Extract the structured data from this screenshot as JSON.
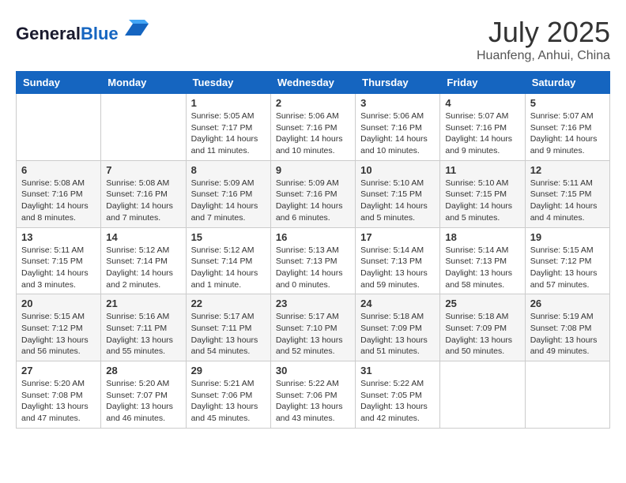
{
  "header": {
    "logo_general": "General",
    "logo_blue": "Blue",
    "month_year": "July 2025",
    "location": "Huanfeng, Anhui, China"
  },
  "weekdays": [
    "Sunday",
    "Monday",
    "Tuesday",
    "Wednesday",
    "Thursday",
    "Friday",
    "Saturday"
  ],
  "weeks": [
    [
      {
        "day": "",
        "info": ""
      },
      {
        "day": "",
        "info": ""
      },
      {
        "day": "1",
        "info": "Sunrise: 5:05 AM\nSunset: 7:17 PM\nDaylight: 14 hours and 11 minutes."
      },
      {
        "day": "2",
        "info": "Sunrise: 5:06 AM\nSunset: 7:16 PM\nDaylight: 14 hours and 10 minutes."
      },
      {
        "day": "3",
        "info": "Sunrise: 5:06 AM\nSunset: 7:16 PM\nDaylight: 14 hours and 10 minutes."
      },
      {
        "day": "4",
        "info": "Sunrise: 5:07 AM\nSunset: 7:16 PM\nDaylight: 14 hours and 9 minutes."
      },
      {
        "day": "5",
        "info": "Sunrise: 5:07 AM\nSunset: 7:16 PM\nDaylight: 14 hours and 9 minutes."
      }
    ],
    [
      {
        "day": "6",
        "info": "Sunrise: 5:08 AM\nSunset: 7:16 PM\nDaylight: 14 hours and 8 minutes."
      },
      {
        "day": "7",
        "info": "Sunrise: 5:08 AM\nSunset: 7:16 PM\nDaylight: 14 hours and 7 minutes."
      },
      {
        "day": "8",
        "info": "Sunrise: 5:09 AM\nSunset: 7:16 PM\nDaylight: 14 hours and 7 minutes."
      },
      {
        "day": "9",
        "info": "Sunrise: 5:09 AM\nSunset: 7:16 PM\nDaylight: 14 hours and 6 minutes."
      },
      {
        "day": "10",
        "info": "Sunrise: 5:10 AM\nSunset: 7:15 PM\nDaylight: 14 hours and 5 minutes."
      },
      {
        "day": "11",
        "info": "Sunrise: 5:10 AM\nSunset: 7:15 PM\nDaylight: 14 hours and 5 minutes."
      },
      {
        "day": "12",
        "info": "Sunrise: 5:11 AM\nSunset: 7:15 PM\nDaylight: 14 hours and 4 minutes."
      }
    ],
    [
      {
        "day": "13",
        "info": "Sunrise: 5:11 AM\nSunset: 7:15 PM\nDaylight: 14 hours and 3 minutes."
      },
      {
        "day": "14",
        "info": "Sunrise: 5:12 AM\nSunset: 7:14 PM\nDaylight: 14 hours and 2 minutes."
      },
      {
        "day": "15",
        "info": "Sunrise: 5:12 AM\nSunset: 7:14 PM\nDaylight: 14 hours and 1 minute."
      },
      {
        "day": "16",
        "info": "Sunrise: 5:13 AM\nSunset: 7:13 PM\nDaylight: 14 hours and 0 minutes."
      },
      {
        "day": "17",
        "info": "Sunrise: 5:14 AM\nSunset: 7:13 PM\nDaylight: 13 hours and 59 minutes."
      },
      {
        "day": "18",
        "info": "Sunrise: 5:14 AM\nSunset: 7:13 PM\nDaylight: 13 hours and 58 minutes."
      },
      {
        "day": "19",
        "info": "Sunrise: 5:15 AM\nSunset: 7:12 PM\nDaylight: 13 hours and 57 minutes."
      }
    ],
    [
      {
        "day": "20",
        "info": "Sunrise: 5:15 AM\nSunset: 7:12 PM\nDaylight: 13 hours and 56 minutes."
      },
      {
        "day": "21",
        "info": "Sunrise: 5:16 AM\nSunset: 7:11 PM\nDaylight: 13 hours and 55 minutes."
      },
      {
        "day": "22",
        "info": "Sunrise: 5:17 AM\nSunset: 7:11 PM\nDaylight: 13 hours and 54 minutes."
      },
      {
        "day": "23",
        "info": "Sunrise: 5:17 AM\nSunset: 7:10 PM\nDaylight: 13 hours and 52 minutes."
      },
      {
        "day": "24",
        "info": "Sunrise: 5:18 AM\nSunset: 7:09 PM\nDaylight: 13 hours and 51 minutes."
      },
      {
        "day": "25",
        "info": "Sunrise: 5:18 AM\nSunset: 7:09 PM\nDaylight: 13 hours and 50 minutes."
      },
      {
        "day": "26",
        "info": "Sunrise: 5:19 AM\nSunset: 7:08 PM\nDaylight: 13 hours and 49 minutes."
      }
    ],
    [
      {
        "day": "27",
        "info": "Sunrise: 5:20 AM\nSunset: 7:08 PM\nDaylight: 13 hours and 47 minutes."
      },
      {
        "day": "28",
        "info": "Sunrise: 5:20 AM\nSunset: 7:07 PM\nDaylight: 13 hours and 46 minutes."
      },
      {
        "day": "29",
        "info": "Sunrise: 5:21 AM\nSunset: 7:06 PM\nDaylight: 13 hours and 45 minutes."
      },
      {
        "day": "30",
        "info": "Sunrise: 5:22 AM\nSunset: 7:06 PM\nDaylight: 13 hours and 43 minutes."
      },
      {
        "day": "31",
        "info": "Sunrise: 5:22 AM\nSunset: 7:05 PM\nDaylight: 13 hours and 42 minutes."
      },
      {
        "day": "",
        "info": ""
      },
      {
        "day": "",
        "info": ""
      }
    ]
  ]
}
